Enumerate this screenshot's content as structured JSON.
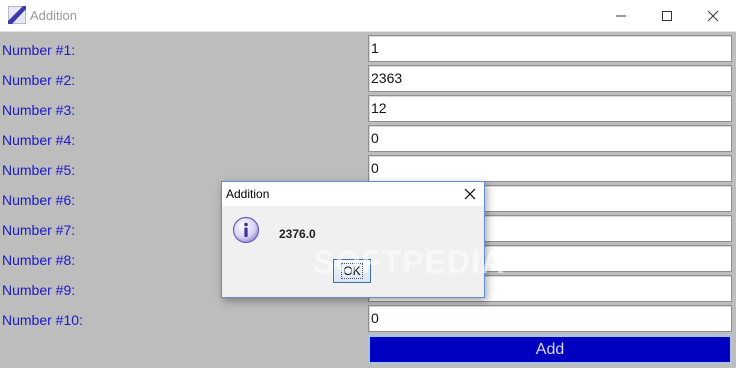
{
  "window": {
    "title": "Addition",
    "icon": "diagonal-stripe-app-icon",
    "controls": [
      "minimize-icon",
      "maximize-icon",
      "close-icon"
    ]
  },
  "form": {
    "rows": [
      {
        "label": "Number #1:",
        "value": "1"
      },
      {
        "label": "Number #2:",
        "value": "2363"
      },
      {
        "label": "Number #3:",
        "value": "12"
      },
      {
        "label": "Number #4:",
        "value": "0"
      },
      {
        "label": "Number #5:",
        "value": "0"
      },
      {
        "label": "Number #6:",
        "value": ""
      },
      {
        "label": "Number #7:",
        "value": ""
      },
      {
        "label": "Number #8:",
        "value": ""
      },
      {
        "label": "Number #9:",
        "value": ""
      },
      {
        "label": "Number #10:",
        "value": "0"
      }
    ],
    "add_label": "Add"
  },
  "dialog": {
    "title": "Addition",
    "message": "2376.0",
    "ok_label": "OK",
    "icon": "info-icon"
  },
  "watermark": {
    "text": "SOFTPEDIA",
    "mark": "®"
  },
  "colors": {
    "label_text": "#1a1ac8",
    "panel_bg": "#bdbdbd",
    "add_button": "#0000c0",
    "dialog_border": "#5b8ed6"
  }
}
